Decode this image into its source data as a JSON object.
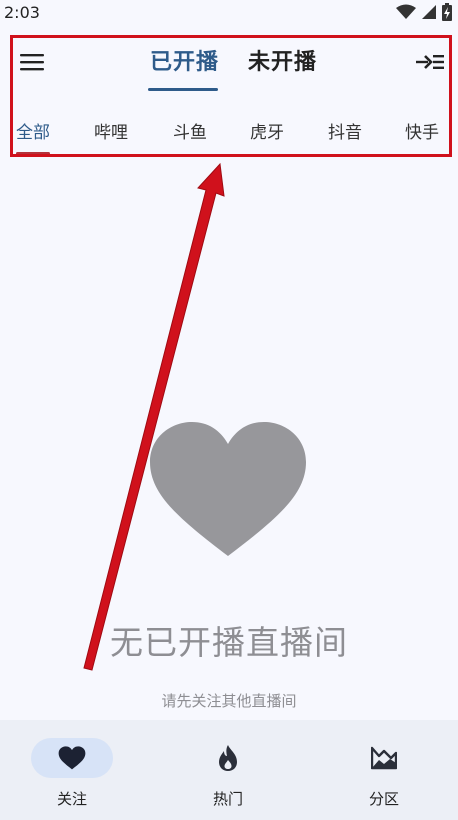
{
  "status": {
    "time": "2:03"
  },
  "header": {
    "tabs": [
      {
        "label": "已开播",
        "active": true
      },
      {
        "label": "未开播",
        "active": false
      }
    ],
    "menu_icon": "hamburger-menu-icon",
    "exit_icon": "arrow-to-list-icon"
  },
  "platforms": [
    {
      "label": "全部",
      "active": true
    },
    {
      "label": "哔哩"
    },
    {
      "label": "斗鱼"
    },
    {
      "label": "虎牙"
    },
    {
      "label": "抖音"
    },
    {
      "label": "快手"
    }
  ],
  "empty": {
    "icon": "heart-icon",
    "title": "无已开播直播间",
    "subtitle": "请先关注其他直播间"
  },
  "bottom_nav": [
    {
      "label": "关注",
      "icon": "heart-icon",
      "active": true
    },
    {
      "label": "热门",
      "icon": "flame-icon",
      "active": false
    },
    {
      "label": "分区",
      "icon": "landscape-icon",
      "active": false
    }
  ],
  "colors": {
    "accent": "#2e5b8a",
    "annotation_red": "#d0111c",
    "background": "#f7f8fe",
    "nav_background": "#eceff6",
    "nav_active_pill": "#d7e3f7",
    "empty_gray": "#8e8e93"
  }
}
